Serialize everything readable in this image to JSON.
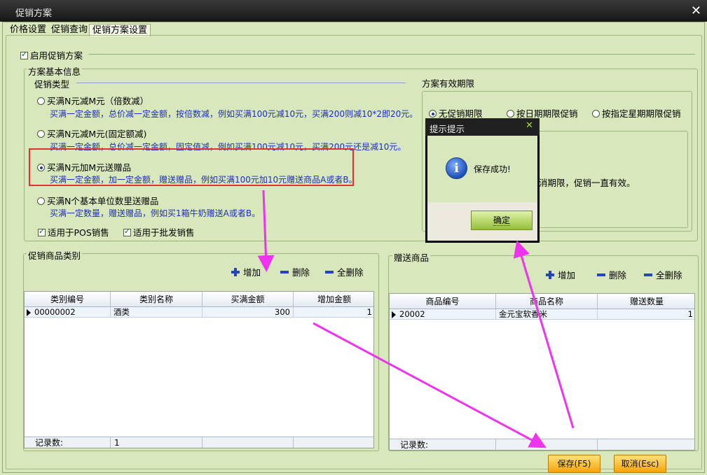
{
  "window": {
    "title": "促销方案",
    "close_glyph": "✕"
  },
  "tabs": [
    {
      "label": "价格设置"
    },
    {
      "label": "促销查询"
    },
    {
      "label": "促销方案设置"
    }
  ],
  "enable_promo": {
    "label": "启用促销方案",
    "checked": true
  },
  "basic_info": {
    "title": "方案基本信息"
  },
  "promo_type": {
    "title": "促销类型",
    "options": [
      {
        "label": "买满N元减M元（倍数减）",
        "desc": "买满一定金额，总价减一定金额，按倍数减，例如买满100元减10元，买满200则减10*2即20元。",
        "selected": false
      },
      {
        "label": "买满N元减M元(固定额减)",
        "desc": "买满一定金额，总价减一定金额，固定值减，例如买满100元减10元，买满200元还是减10元。",
        "selected": false
      },
      {
        "label": "买满N元加M元送赠品",
        "desc": "买满一定金额，加一定金额，赠送赠品，例如买满100元加10元赠送商品A或者B。",
        "selected": true
      },
      {
        "label": "买满N个基本单位数里送赠品",
        "desc": "买满一定数量，赠送赠品，例如买1箱牛奶赠送A或者B。",
        "selected": false
      }
    ],
    "apply_pos": {
      "label": "适用于POS销售",
      "checked": true
    },
    "apply_wholesale": {
      "label": "适用于批发销售",
      "checked": true
    }
  },
  "validity": {
    "title": "方案有效期限",
    "options": [
      {
        "label": "无促销期限",
        "selected": true
      },
      {
        "label": "按日期期限促销",
        "selected": false
      },
      {
        "label": "按指定星期期限促销",
        "selected": false
      }
    ],
    "note": "消期限，促销一直有效。"
  },
  "category_panel": {
    "title": "促销商品类别",
    "add": "增加",
    "delete": "删除",
    "delete_all": "全删除",
    "columns": [
      "类别编号",
      "类别名称",
      "买满金额",
      "增加金额"
    ],
    "rows": [
      {
        "code": "00000002",
        "name": "酒类",
        "amount": "300",
        "add": "1"
      }
    ],
    "footer_label": "记录数:",
    "footer_count": "1"
  },
  "gift_panel": {
    "title": "赠送商品",
    "add": "增加",
    "delete": "删除",
    "delete_all": "全删除",
    "columns": [
      "商品编号",
      "商品名称",
      "赠送数量"
    ],
    "rows": [
      {
        "code": "20002",
        "name": "金元宝软香米",
        "qty": "1"
      }
    ],
    "footer_label": "记录数:"
  },
  "buttons": {
    "save": "保存(F5)",
    "cancel": "取消(Esc)"
  },
  "dialog": {
    "title": "提示提示",
    "close_glyph": "✕",
    "message": "保存成功!",
    "ok": "确定",
    "info_glyph": "i"
  },
  "colors": {
    "highlight_box": "#e03030",
    "arrow": "#ee33ee",
    "panel_bg": "#d9e7bd"
  }
}
